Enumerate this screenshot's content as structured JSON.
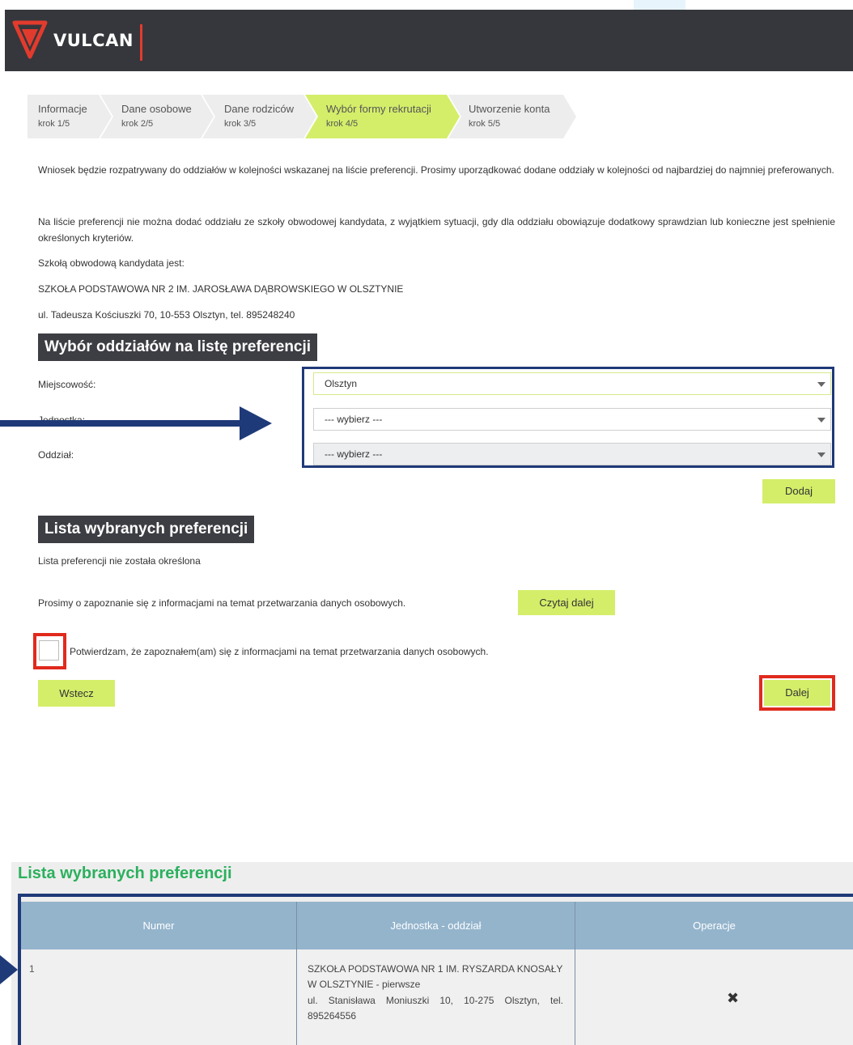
{
  "header": {
    "brand": "VULCAN",
    "brand_color": "#36373c",
    "accent": "#e23b2d"
  },
  "steps": [
    {
      "label": "Informacje",
      "sub": "krok 1/5",
      "active": false
    },
    {
      "label": "Dane osobowe",
      "sub": "krok 2/5",
      "active": false
    },
    {
      "label": "Dane rodziców",
      "sub": "krok 3/5",
      "active": false
    },
    {
      "label": "Wybór formy rekrutacji",
      "sub": "krok 4/5",
      "active": true
    },
    {
      "label": "Utworzenie konta",
      "sub": "krok 5/5",
      "active": false
    }
  ],
  "intro": {
    "p1": "Wniosek będzie rozpatrywany do oddziałów w kolejności wskazanej na liście preferencji. Prosimy uporządkować dodane oddziały w kolejności od najbardziej do najmniej preferowanych.",
    "p2": "Na liście preferencji nie można dodać oddziału ze szkoły obwodowej kandydata, z wyjątkiem sytuacji, gdy dla oddziału obowiązuje dodatkowy sprawdzian lub konieczne jest spełnienie określonych kryteriów.",
    "school_label": "Szkołą obwodową kandydata jest:",
    "school_name": "SZKOŁA PODSTAWOWA NR 2 IM. JAROSŁAWA DĄBROWSKIEGO W OLSZTYNIE",
    "school_address": "ul. Tadeusza Kościuszki 70, 10-553 Olsztyn, tel. 895248240"
  },
  "selection": {
    "title": "Wybór oddziałów na listę preferencji",
    "fields": [
      {
        "label": "Miejscowość:",
        "value": "Olsztyn"
      },
      {
        "label": "Jednostka:",
        "value": "--- wybierz ---"
      },
      {
        "label": "Oddział:",
        "value": "--- wybierz ---"
      }
    ],
    "add_button": "Dodaj"
  },
  "preferences": {
    "title": "Lista wybranych preferencji",
    "empty_text": "Lista preferencji nie została określona",
    "info_text": "Prosimy o zapoznanie się z informacjami na temat przetwarzania danych osobowych.",
    "read_more": "Czytaj dalej",
    "confirm_text": "Potwierdzam, że zapoznałem(am) się z informacjami na temat przetwarzania danych osobowych.",
    "back_button": "Wstecz",
    "next_button": "Dalej"
  },
  "inset": {
    "title": "Lista wybranych preferencji",
    "columns": [
      "Numer",
      "Jednostka - oddział",
      "Operacje"
    ],
    "rows": [
      {
        "number": "1",
        "school": "SZKOŁA PODSTAWOWA NR 1 IM. RYSZARDA KNOSAŁY W OLSZTYNIE - pierwsze",
        "address": "ul. Stanisława Moniuszki 10, 10-275 Olsztyn, tel. 895264556",
        "op_icon": "✖"
      }
    ]
  }
}
